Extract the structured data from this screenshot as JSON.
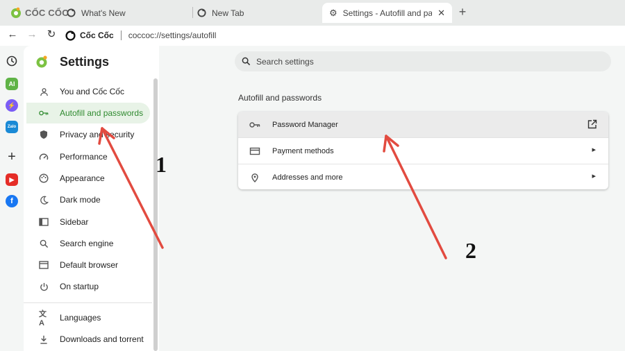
{
  "browser": {
    "brand": "CỐC CỐC",
    "tabs": [
      {
        "title": "What's New",
        "icon": "coccoc-icon"
      },
      {
        "title": "New Tab",
        "icon": "coccoc-icon"
      },
      {
        "title": "Settings - Autofill and pass",
        "icon": "gear-icon",
        "active": true
      }
    ],
    "omnibox": {
      "brand": "Cốc Cốc",
      "url": "coccoc://settings/autofill"
    }
  },
  "rail": {
    "items": [
      "history-icon",
      "ai-icon",
      "messenger-icon",
      "zalo-icon",
      "add-icon",
      "youtube-icon",
      "facebook-icon"
    ],
    "ai_label": "AI",
    "zalo_label": "Zalo"
  },
  "sidebar": {
    "title": "Settings",
    "items": [
      {
        "label": "You and Cốc Cốc",
        "icon": "person-icon"
      },
      {
        "label": "Autofill and passwords",
        "icon": "key-icon",
        "active": true
      },
      {
        "label": "Privacy and security",
        "icon": "shield-icon"
      },
      {
        "label": "Performance",
        "icon": "speedometer-icon"
      },
      {
        "label": "Appearance",
        "icon": "palette-icon"
      },
      {
        "label": "Dark mode",
        "icon": "moon-icon"
      },
      {
        "label": "Sidebar",
        "icon": "sidebar-icon"
      },
      {
        "label": "Search engine",
        "icon": "search-icon"
      },
      {
        "label": "Default browser",
        "icon": "browser-icon"
      },
      {
        "label": "On startup",
        "icon": "power-icon"
      },
      {
        "label": "Languages",
        "icon": "translate-icon"
      },
      {
        "label": "Downloads and torrent",
        "icon": "download-icon"
      }
    ]
  },
  "main": {
    "search_placeholder": "Search settings",
    "section_title": "Autofill and passwords",
    "rows": [
      {
        "label": "Password Manager",
        "icon": "key-icon",
        "end": "external-link-icon"
      },
      {
        "label": "Payment methods",
        "icon": "card-icon",
        "end": "chevron-right-icon"
      },
      {
        "label": "Addresses and more",
        "icon": "location-icon",
        "end": "chevron-right-icon"
      }
    ]
  },
  "annotations": {
    "label_1": "1",
    "label_2": "2",
    "arrow_color": "#e24b40"
  },
  "colors": {
    "accent": "#2f8a2f",
    "active_bg": "#e8f3e7"
  }
}
